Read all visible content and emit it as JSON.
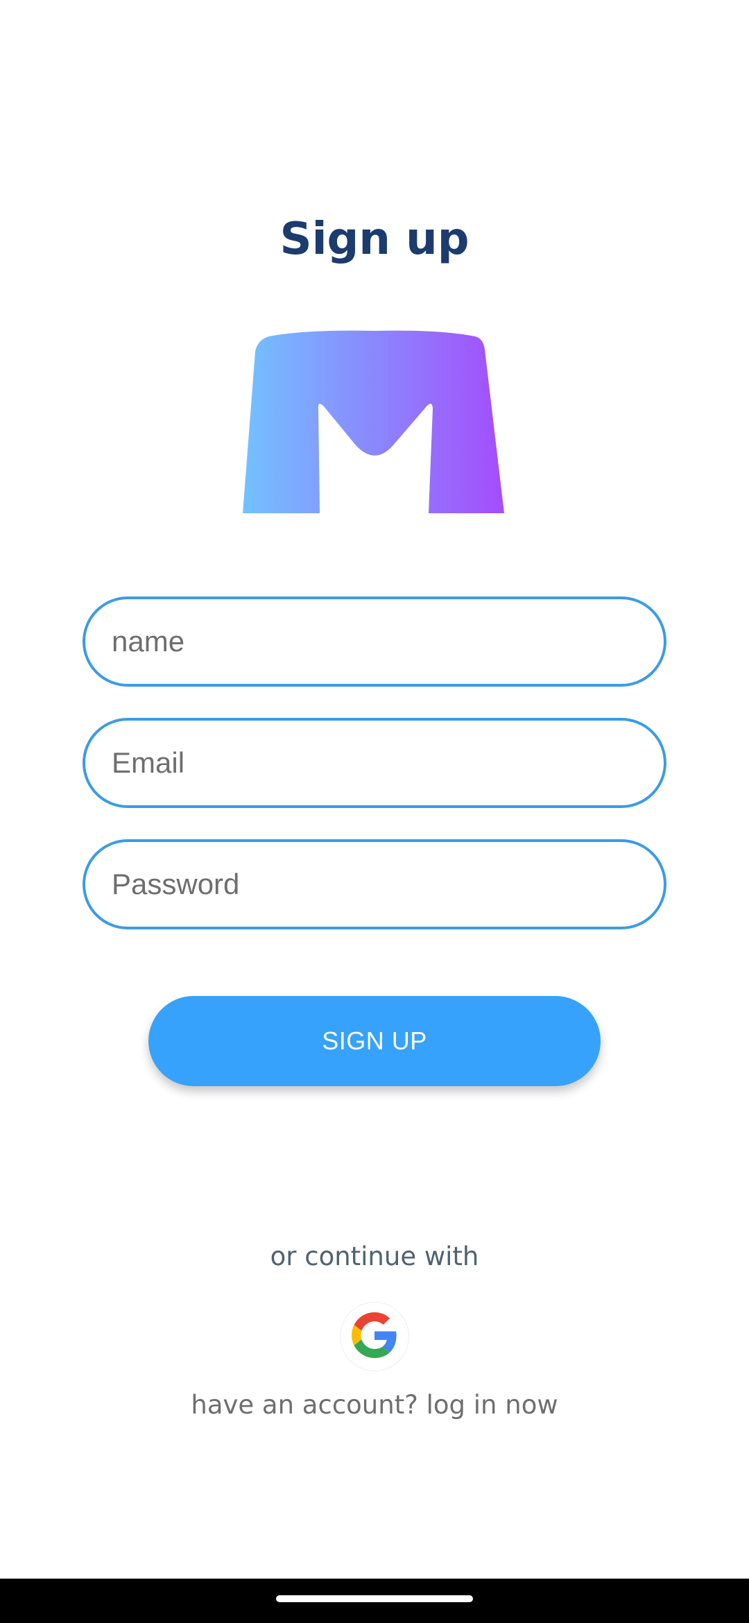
{
  "header": {
    "title": "Sign up"
  },
  "logo": {
    "icon": "m-logo-icon",
    "gradient_start": "#72c2ff",
    "gradient_end": "#a44dfb"
  },
  "form": {
    "name_placeholder": "name",
    "name_value": "",
    "email_placeholder": "Email",
    "email_value": "",
    "password_placeholder": "Password",
    "password_value": "",
    "field_border_color": "#3b9be8",
    "submit_label": "SIGN UP",
    "submit_color": "#36a2fb"
  },
  "social": {
    "continue_text": "or continue with",
    "google_icon": "google-icon"
  },
  "footer": {
    "login_text": "have an account? log in now"
  },
  "colors": {
    "title": "#1c3b6e",
    "background": "#ffffff"
  }
}
